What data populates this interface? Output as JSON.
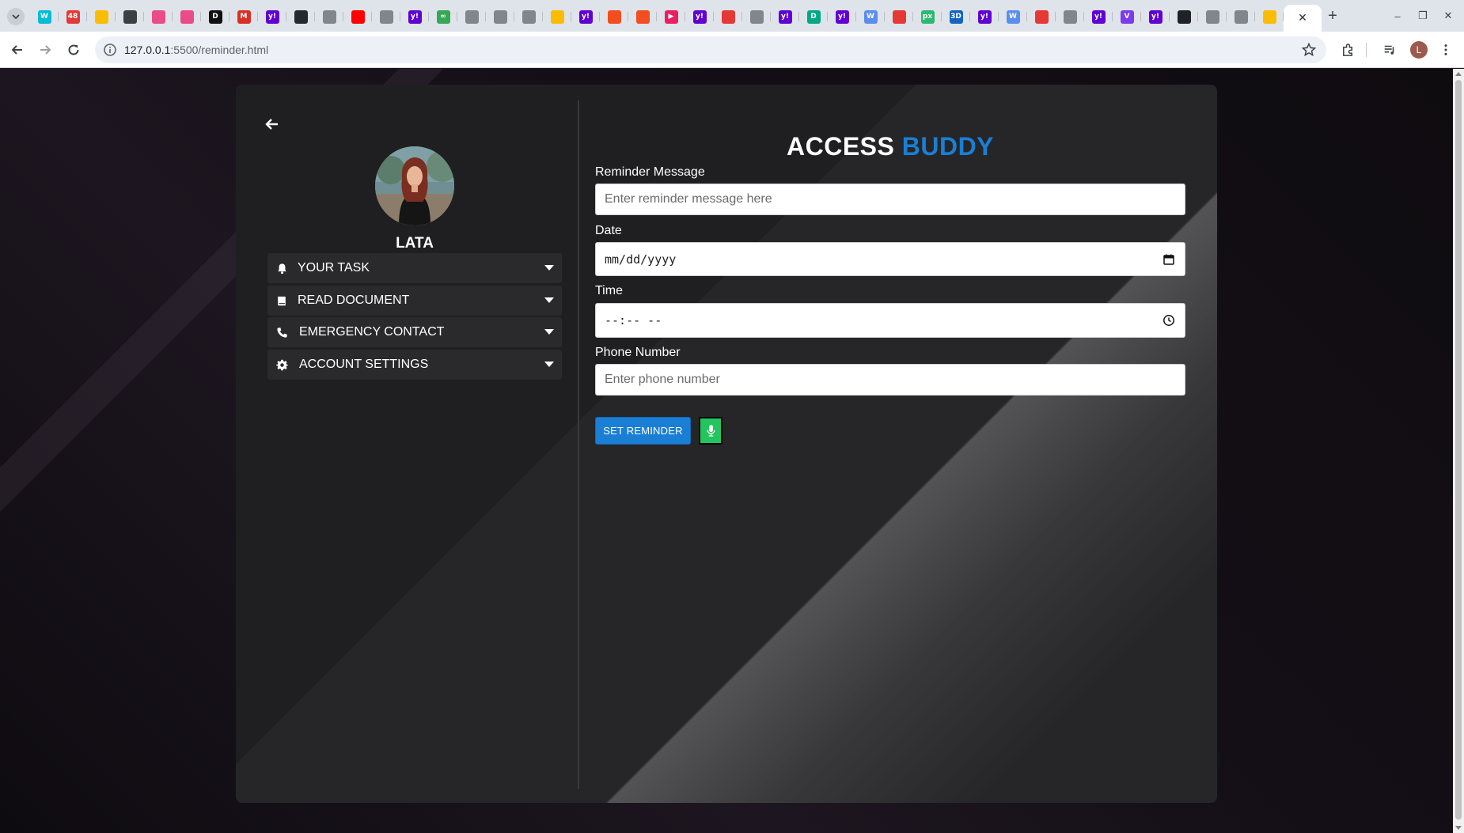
{
  "browser": {
    "tabs": [
      {
        "icon": "tab-list-icon",
        "label": "",
        "color": "#c8cdd6"
      },
      {
        "icon": "wikipedia-favicon",
        "label": "W",
        "color": "#00bcd4"
      },
      {
        "icon": "mail-favicon",
        "label": "48",
        "color": "#e53935"
      },
      {
        "icon": "drive-favicon",
        "label": "",
        "color": "#fbbc04"
      },
      {
        "icon": "chatgpt-favicon",
        "label": "",
        "color": "#3c4043"
      },
      {
        "icon": "dribbble-favicon",
        "label": "",
        "color": "#ea4c89"
      },
      {
        "icon": "dribbble-favicon",
        "label": "",
        "color": "#ea4c89"
      },
      {
        "icon": "d-favicon",
        "label": "D",
        "color": "#111111"
      },
      {
        "icon": "gmail-favicon",
        "label": "M",
        "color": "#d93025"
      },
      {
        "icon": "yahoo-favicon",
        "label": "y!",
        "color": "#6001d2"
      },
      {
        "icon": "github-favicon",
        "label": "",
        "color": "#24292f"
      },
      {
        "icon": "globe-favicon",
        "label": "",
        "color": "#80868b"
      },
      {
        "icon": "youtube-favicon",
        "label": "",
        "color": "#ff0000"
      },
      {
        "icon": "globe-favicon",
        "label": "",
        "color": "#80868b"
      },
      {
        "icon": "yahoo-favicon",
        "label": "y!",
        "color": "#6001d2"
      },
      {
        "icon": "infinity-favicon",
        "label": "∞",
        "color": "#34a853"
      },
      {
        "icon": "globe-favicon",
        "label": "",
        "color": "#80868b"
      },
      {
        "icon": "globe-favicon",
        "label": "",
        "color": "#80868b"
      },
      {
        "icon": "globe-favicon",
        "label": "",
        "color": "#80868b"
      },
      {
        "icon": "drive-favicon",
        "label": "",
        "color": "#fbbc04"
      },
      {
        "icon": "yahoo-favicon",
        "label": "y!",
        "color": "#6001d2"
      },
      {
        "icon": "figma-favicon",
        "label": "",
        "color": "#f24e1e"
      },
      {
        "icon": "figma-favicon",
        "label": "",
        "color": "#f24e1e"
      },
      {
        "icon": "play-favicon",
        "label": "▶",
        "color": "#e91e63"
      },
      {
        "icon": "yahoo-favicon",
        "label": "y!",
        "color": "#6001d2"
      },
      {
        "icon": "shield-favicon",
        "label": "",
        "color": "#e53935"
      },
      {
        "icon": "globe-favicon",
        "label": "",
        "color": "#80868b"
      },
      {
        "icon": "yahoo-favicon",
        "label": "y!",
        "color": "#6001d2"
      },
      {
        "icon": "d-favicon",
        "label": "D",
        "color": "#00a884"
      },
      {
        "icon": "yahoo-favicon",
        "label": "y!",
        "color": "#6001d2"
      },
      {
        "icon": "w-favicon",
        "label": "W",
        "color": "#5b8def"
      },
      {
        "icon": "red-favicon",
        "label": "",
        "color": "#e53935"
      },
      {
        "icon": "px-favicon",
        "label": "px",
        "color": "#2eb872"
      },
      {
        "icon": "3d-favicon",
        "label": "3D",
        "color": "#1565c0"
      },
      {
        "icon": "yahoo-favicon",
        "label": "y!",
        "color": "#6001d2"
      },
      {
        "icon": "w-favicon",
        "label": "W",
        "color": "#5b8def"
      },
      {
        "icon": "red-favicon",
        "label": "",
        "color": "#e53935"
      },
      {
        "icon": "globe-favicon",
        "label": "",
        "color": "#80868b"
      },
      {
        "icon": "yahoo-favicon",
        "label": "y!",
        "color": "#6001d2"
      },
      {
        "icon": "v-favicon",
        "label": "V",
        "color": "#7c3aed"
      },
      {
        "icon": "yahoo-favicon",
        "label": "y!",
        "color": "#6001d2"
      },
      {
        "icon": "mail-dark-favicon",
        "label": "",
        "color": "#202124"
      },
      {
        "icon": "globe-favicon",
        "label": "",
        "color": "#80868b"
      },
      {
        "icon": "globe-favicon",
        "label": "",
        "color": "#80868b"
      },
      {
        "icon": "drive-favicon",
        "label": "",
        "color": "#fbbc04"
      }
    ],
    "active_tab_close": "✕",
    "new_tab": "+",
    "window_controls": {
      "minimize": "–",
      "restore": "❐",
      "close": "✕"
    },
    "url_host": "127.0.0.1",
    "url_rest": ":5500/reminder.html",
    "profile_initial": "L"
  },
  "sidebar": {
    "user_name": "LATA",
    "menu": [
      {
        "icon": "bell-icon",
        "label": "YOUR TASK"
      },
      {
        "icon": "book-icon",
        "label": "READ DOCUMENT"
      },
      {
        "icon": "phone-icon",
        "label": "EMERGENCY CONTACT"
      },
      {
        "icon": "gear-icon",
        "label": "ACCOUNT SETTINGS"
      }
    ]
  },
  "main": {
    "title_part1": "ACCESS",
    "title_part2": "BUDDY",
    "reminder_label": "Reminder Message",
    "reminder_placeholder": "Enter reminder message here",
    "date_label": "Date",
    "date_value": "mm/dd/yyyy",
    "time_label": "Time",
    "time_value": "--:-- --",
    "phone_label": "Phone Number",
    "phone_placeholder": "Enter phone number",
    "set_button": "SET REMINDER"
  },
  "colors": {
    "accent": "#1a7fd4",
    "mic_button": "#22c55e",
    "card": "#1f1f21",
    "menu_item": "#2a2a2c"
  }
}
